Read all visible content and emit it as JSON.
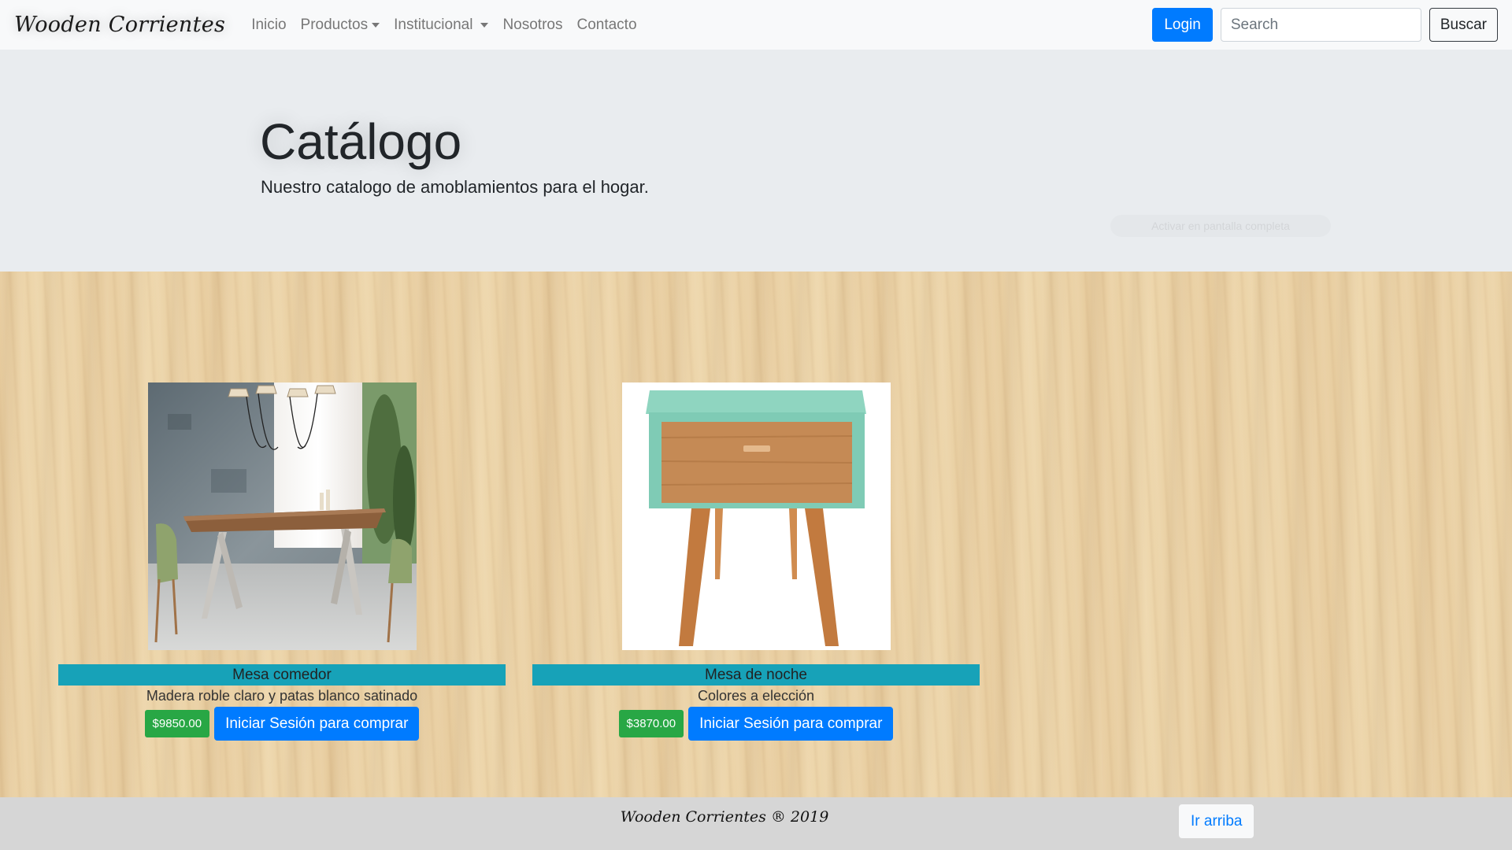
{
  "navbar": {
    "brand": "Wooden Corrientes",
    "links": [
      {
        "label": "Inicio",
        "dropdown": false
      },
      {
        "label": "Productos",
        "dropdown": true
      },
      {
        "label": "Institucional",
        "dropdown": true
      },
      {
        "label": "Nosotros",
        "dropdown": false
      },
      {
        "label": "Contacto",
        "dropdown": false
      }
    ],
    "login_label": "Login",
    "search_placeholder": "Search",
    "search_button": "Buscar"
  },
  "jumbotron": {
    "title": "Catálogo",
    "subtitle": "Nuestro catalogo de amoblamientos para el hogar.",
    "fullscreen_hint": "Activar en pantalla completa"
  },
  "products": [
    {
      "name": "Mesa comedor",
      "description": "Madera roble claro y patas blanco satinado",
      "price": "$9850.00",
      "buy_label": "Iniciar Sesión para comprar"
    },
    {
      "name": "Mesa de noche",
      "description": "Colores a elección",
      "price": "$3870.00",
      "buy_label": "Iniciar Sesión para comprar"
    }
  ],
  "footer": {
    "text": "Wooden Corrientes ® 2019",
    "top_button": "Ir arriba"
  },
  "colors": {
    "primary": "#007bff",
    "info": "#17a2b8",
    "success": "#28a745",
    "jumbotron_bg": "#e9ecef",
    "navbar_bg": "#f8f9fa",
    "footer_bg": "#d6d6d6"
  }
}
